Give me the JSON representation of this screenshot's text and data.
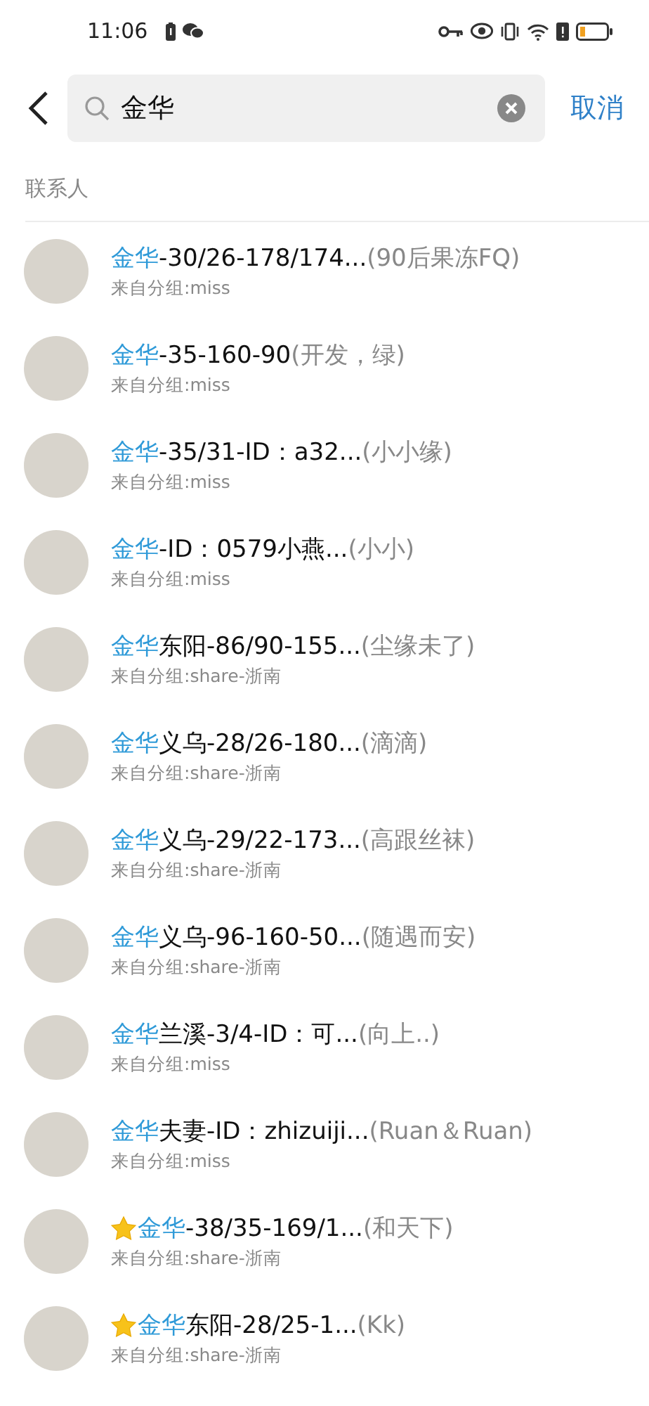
{
  "status_bar": {
    "time": "11:06"
  },
  "search": {
    "value": "金华",
    "cancel": "取消"
  },
  "section": {
    "title": "联系人"
  },
  "contacts": [
    {
      "starred": false,
      "match": "金华",
      "rest": "-30/26-178/174...",
      "nickname": "(90后果冻FQ)",
      "group": "来自分组:miss"
    },
    {
      "starred": false,
      "match": "金华",
      "rest": "-35-160-90",
      "nickname": "(开发，绿)",
      "group": "来自分组:miss"
    },
    {
      "starred": false,
      "match": "金华",
      "rest": "-35/31-ID：a32...",
      "nickname": "(小小缘)",
      "group": "来自分组:miss"
    },
    {
      "starred": false,
      "match": "金华",
      "rest": "-ID：0579小燕...",
      "nickname": "(小小)",
      "group": "来自分组:miss"
    },
    {
      "starred": false,
      "match": "金华",
      "rest": "东阳-86/90-155...",
      "nickname": "(尘缘未了)",
      "group": "来自分组:share-浙南"
    },
    {
      "starred": false,
      "match": "金华",
      "rest": "义乌-28/26-180...",
      "nickname": "(滴滴)",
      "group": "来自分组:share-浙南"
    },
    {
      "starred": false,
      "match": "金华",
      "rest": "义乌-29/22-173...",
      "nickname": "(高跟丝袜)",
      "group": "来自分组:share-浙南"
    },
    {
      "starred": false,
      "match": "金华",
      "rest": "义乌-96-160-50...",
      "nickname": "(随遇而安)",
      "group": "来自分组:share-浙南"
    },
    {
      "starred": false,
      "match": "金华",
      "rest": "兰溪-3/4-ID：可...",
      "nickname": "(向上..)",
      "group": "来自分组:miss"
    },
    {
      "starred": false,
      "match": "金华",
      "rest": "夫妻-ID：zhizuiji...",
      "nickname": "(Ruan＆Ruan)",
      "group": "来自分组:miss"
    },
    {
      "starred": true,
      "match": "金华",
      "rest": "-38/35-169/1...",
      "nickname": "(和天下)",
      "group": "来自分组:share-浙南"
    },
    {
      "starred": true,
      "match": "金华",
      "rest": "东阳-28/25-1...",
      "nickname": "(Kk)",
      "group": "来自分组:share-浙南"
    }
  ]
}
